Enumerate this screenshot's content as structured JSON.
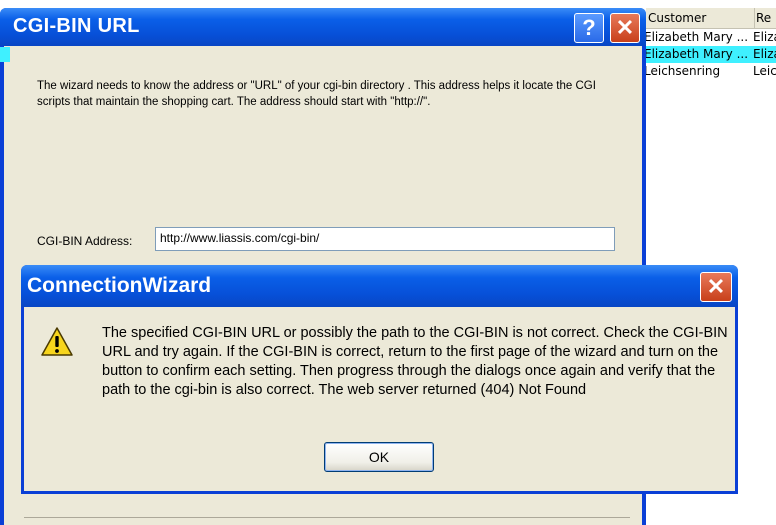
{
  "background_list": {
    "columns": [
      "Customer",
      "Re"
    ],
    "rows": [
      {
        "name": "Elizabeth Mary ...",
        "col2": "Eliza",
        "selected": false
      },
      {
        "name": "Elizabeth Mary ...",
        "col2": "Eliza",
        "selected": true
      },
      {
        "name": "Leichsenring",
        "col2": "Leic",
        "selected": false
      }
    ]
  },
  "cgi_window": {
    "title": "CGI-BIN URL",
    "help_glyph": "?",
    "close_glyph": "✕",
    "description": "The wizard needs to know the address or \"URL\" of your cgi-bin directory .  This address helps it locate the CGI scripts that maintain the shopping cart.  The address should start with \"http://\".",
    "address_label": "CGI-BIN Address:",
    "address_value": "http://www.liassis.com/cgi-bin/"
  },
  "dialog": {
    "title": "ConnectionWizard",
    "close_glyph": "✕",
    "message": "The specified CGI-BIN URL or possibly the path to the CGI-BIN is not correct.  Check the CGI-BIN URL and try again.  If the CGI-BIN is correct, return to the first page of the wizard and turn on the button to confirm each setting.  Then progress through the dialogs once again and verify that the path to the cgi-bin is also correct.  The web server returned (404)  Not Found",
    "ok_label": "OK",
    "icon": "warning-icon"
  },
  "colors": {
    "title_blue": "#0a5fe8",
    "selection": "#3ff0ff",
    "dialog_bg": "#ece9d8"
  }
}
